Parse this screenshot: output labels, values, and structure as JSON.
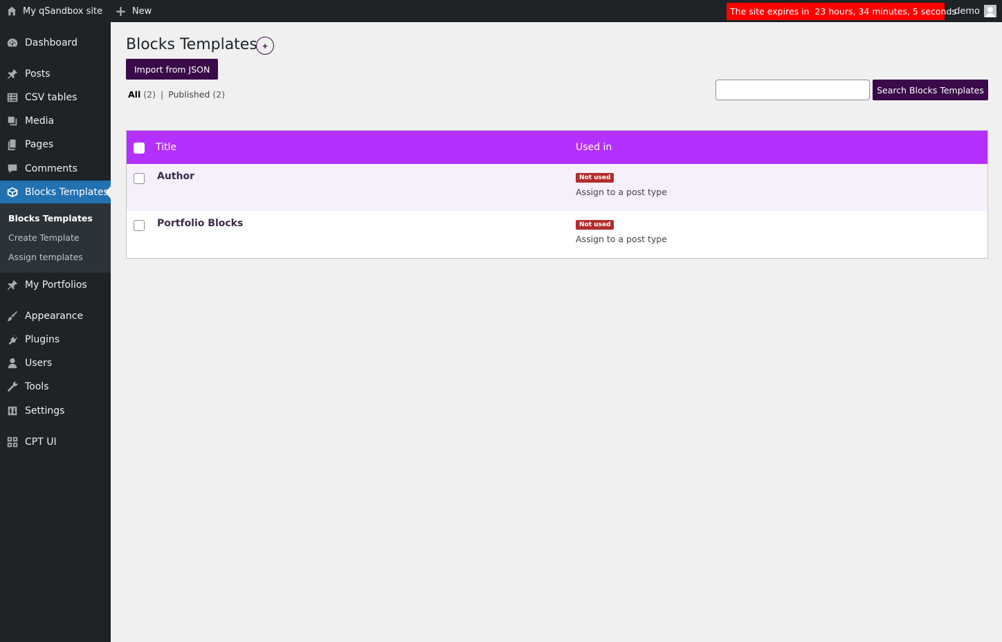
{
  "adminbar": {
    "site_name": "My qSandbox site",
    "new_label": "New",
    "expire_prefix": "The site expires in",
    "expire_countdown": "23 hours, 34 minutes, 5 seconds",
    "user_name": "demo"
  },
  "sidebar": {
    "items": [
      {
        "label": "Dashboard",
        "icon": "dashboard-icon"
      },
      {
        "label": "Posts",
        "icon": "pin-icon"
      },
      {
        "label": "CSV tables",
        "icon": "table-icon"
      },
      {
        "label": "Media",
        "icon": "media-icon"
      },
      {
        "label": "Pages",
        "icon": "pages-icon"
      },
      {
        "label": "Comments",
        "icon": "comment-icon"
      },
      {
        "label": "Blocks Templates",
        "icon": "blocks-icon"
      },
      {
        "label": "My Portfolios",
        "icon": "pin-icon"
      },
      {
        "label": "Appearance",
        "icon": "brush-icon"
      },
      {
        "label": "Plugins",
        "icon": "plugin-icon"
      },
      {
        "label": "Users",
        "icon": "user-icon"
      },
      {
        "label": "Tools",
        "icon": "wrench-icon"
      },
      {
        "label": "Settings",
        "icon": "sliders-icon"
      },
      {
        "label": "CPT UI",
        "icon": "grid-icon"
      }
    ],
    "submenu": [
      {
        "label": "Blocks Templates"
      },
      {
        "label": "Create Template"
      },
      {
        "label": "Assign templates"
      }
    ]
  },
  "main": {
    "title": "Blocks Templates",
    "add_label": "+",
    "import_label": "Import from JSON",
    "filters": {
      "all_label": "All",
      "all_count": "(2)",
      "separator": "|",
      "published_label": "Published",
      "published_count": "(2)"
    },
    "search": {
      "value": "",
      "button_label": "Search Blocks Templates"
    },
    "table": {
      "columns": [
        "Title",
        "Used in"
      ],
      "rows": [
        {
          "title": "Author",
          "badge": "Not used",
          "assign": "Assign to a post type"
        },
        {
          "title": "Portfolio Blocks",
          "badge": "Not used",
          "assign": "Assign to a post type"
        }
      ]
    }
  },
  "colors": {
    "header_purple": "#b330ff",
    "button_dark_purple": "#3a0a4a",
    "expire_red": "#ff0000",
    "badge_red": "#b32d2e",
    "admin_dark": "#1d2327",
    "active_blue": "#2271b1"
  }
}
